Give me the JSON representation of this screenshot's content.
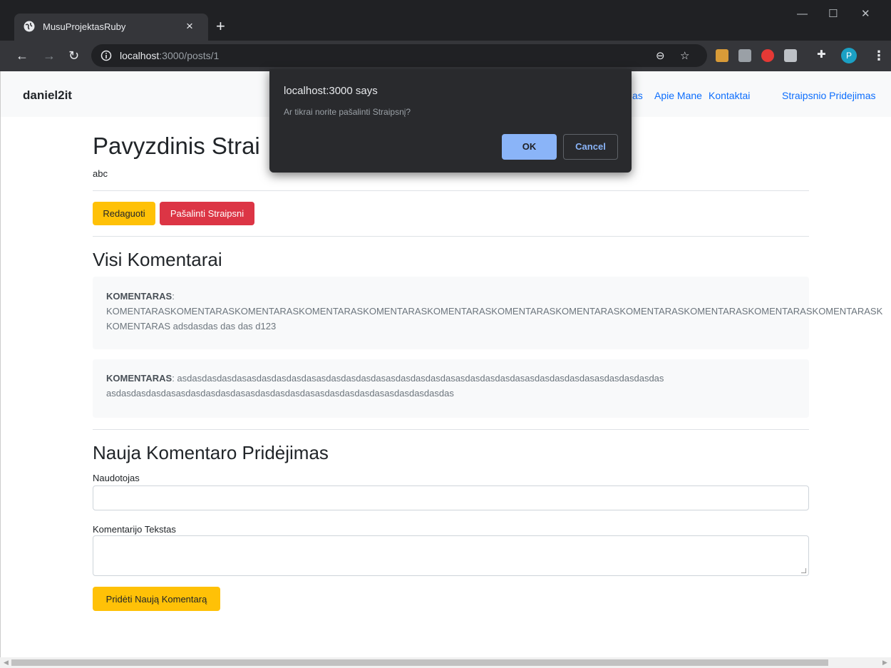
{
  "browser": {
    "tab_title": "MusuProjektasRuby",
    "tab_close": "×",
    "new_tab": "+",
    "url_host": "localhost",
    "url_path": ":3000/posts/1",
    "profile_initial": "P",
    "icons": [
      "globe-icon",
      "info-icon",
      "zoom-icon",
      "star-icon",
      "extension-icon",
      "puzzle-icon",
      "menu-icon"
    ]
  },
  "navbar": {
    "brand": "daniel2it",
    "links": [
      "as",
      "Apie Mane",
      "Kontaktai",
      "Straipsnio Pridejimas"
    ],
    "link_color": "#0d6efd"
  },
  "post": {
    "title": "Pavyzdinis Strai",
    "body": "abc",
    "edit_label": "Redaguoti",
    "delete_label": "Pašalinti Straipsni"
  },
  "comments": {
    "heading": "Visi Komentarai",
    "items": [
      {
        "label": "KOMENTARAS",
        "line1": ":",
        "line2": "KOMENTARASKOMENTARASKOMENTARASKOMENTARASKOMENTARASKOMENTARASKOMENTARASKOMENTARASKOMENTARASKOMENTARASKOMENTARASKOMENTARASK",
        "line3": "KOMENTARAS adsdasdas das das d123"
      },
      {
        "label": "KOMENTARAS",
        "line1": ": asdasdasdasdasasdasdasdasdasasdasdasdasdasasdasdasdasdasasdasdasdasdasasdasdasdasdasasdasdasdasdas",
        "line2": "asdasdasdasdasasdasdasdasdasasdasdasdasdasasdasdasdasdasasdasdasdasdas"
      }
    ]
  },
  "form": {
    "heading": "Nauja Komentaro Pridėjimas",
    "user_label": "Naudotojas",
    "user_value": "",
    "text_label": "Komentarijo Tekstas",
    "text_value": "",
    "submit_label": "Pridėti Naują Komentarą"
  },
  "dialog": {
    "title": "localhost:3000 says",
    "message": "Ar tikrai norite pašalinti Straipsnį?",
    "ok_label": "OK",
    "cancel_label": "Cancel"
  },
  "colors": {
    "warning": "#ffc107",
    "danger": "#dc3545",
    "dialog_bg": "#292a2d",
    "dialog_ok": "#8ab4f8"
  }
}
